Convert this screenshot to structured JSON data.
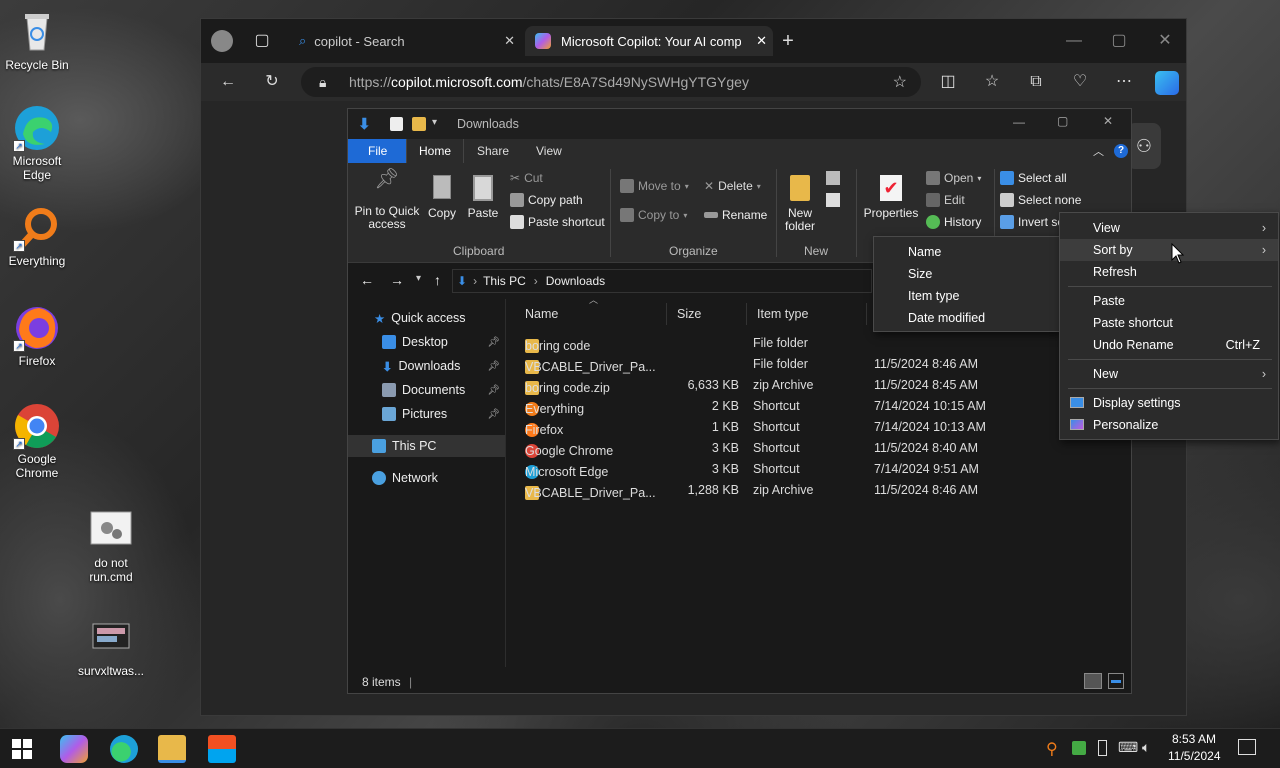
{
  "desktop": {
    "icons": [
      {
        "name": "recycle-bin",
        "label": "Recycle Bin"
      },
      {
        "name": "microsoft-edge",
        "label": "Microsoft Edge"
      },
      {
        "name": "everything",
        "label": "Everything"
      },
      {
        "name": "firefox",
        "label": "Firefox"
      },
      {
        "name": "google-chrome",
        "label": "Google Chrome"
      },
      {
        "name": "do-not-run",
        "label": "do not run.cmd"
      },
      {
        "name": "survxltwas",
        "label": "survxltwas..."
      }
    ]
  },
  "browser": {
    "tabs": [
      {
        "label": "copilot - Search",
        "icon": "search-icon"
      },
      {
        "label": "Microsoft Copilot: Your AI compa",
        "icon": "copilot-icon"
      }
    ],
    "url_prefix": "https://",
    "url_domain": "copilot.microsoft.com",
    "url_path": "/chats/E8A7Sd49NySWHgYTGYgey"
  },
  "explorer": {
    "title": "Downloads",
    "ribbon_tabs": [
      "File",
      "Home",
      "Share",
      "View"
    ],
    "clipboard": {
      "pin": "Pin to Quick access",
      "copy": "Copy",
      "paste": "Paste",
      "cut": "Cut",
      "copy_path": "Copy path",
      "paste_shortcut": "Paste shortcut",
      "group": "Clipboard"
    },
    "organize": {
      "move_to": "Move to",
      "copy_to": "Copy to",
      "delete": "Delete",
      "rename": "Rename",
      "group": "Organize"
    },
    "new": {
      "new_folder": "New folder",
      "group": "New"
    },
    "open": {
      "properties": "Properties",
      "open": "Open",
      "edit": "Edit",
      "history": "History"
    },
    "select": {
      "select_all": "Select all",
      "select_none": "Select none",
      "invert": "Invert se"
    },
    "breadcrumb": [
      "This PC",
      "Downloads"
    ],
    "sidebar": [
      {
        "label": "Quick access",
        "icon": "star-icon"
      },
      {
        "label": "Desktop",
        "icon": "desktop-icon",
        "pinned": true
      },
      {
        "label": "Downloads",
        "icon": "download-icon",
        "pinned": true
      },
      {
        "label": "Documents",
        "icon": "documents-icon",
        "pinned": true
      },
      {
        "label": "Pictures",
        "icon": "pictures-icon",
        "pinned": true
      },
      {
        "label": "This PC",
        "icon": "computer-icon"
      },
      {
        "label": "Network",
        "icon": "network-icon"
      }
    ],
    "columns": [
      "Name",
      "Size",
      "Item type"
    ],
    "files": [
      {
        "name": "boring code",
        "size": "",
        "type": "File folder",
        "date": "",
        "icon": "folder"
      },
      {
        "name": "VBCABLE_Driver_Pa...",
        "size": "",
        "type": "File folder",
        "date": "11/5/2024 8:46 AM",
        "icon": "folder"
      },
      {
        "name": "boring code.zip",
        "size": "6,633 KB",
        "type": "zip Archive",
        "date": "11/5/2024 8:45 AM",
        "icon": "zip"
      },
      {
        "name": "Everything",
        "size": "2 KB",
        "type": "Shortcut",
        "date": "7/14/2024 10:15 AM",
        "icon": "everything"
      },
      {
        "name": "Firefox",
        "size": "1 KB",
        "type": "Shortcut",
        "date": "7/14/2024 10:13 AM",
        "icon": "firefox"
      },
      {
        "name": "Google Chrome",
        "size": "3 KB",
        "type": "Shortcut",
        "date": "11/5/2024 8:40 AM",
        "icon": "chrome"
      },
      {
        "name": "Microsoft Edge",
        "size": "3 KB",
        "type": "Shortcut",
        "date": "7/14/2024 9:51 AM",
        "icon": "edge"
      },
      {
        "name": "VBCABLE_Driver_Pa...",
        "size": "1,288 KB",
        "type": "zip Archive",
        "date": "11/5/2024 8:46 AM",
        "icon": "zip"
      }
    ],
    "status": "8 items"
  },
  "context_menu": {
    "items": [
      {
        "label": "View",
        "submenu": true
      },
      {
        "label": "Sort by",
        "submenu": true
      },
      {
        "label": "Refresh"
      },
      {
        "label": "Paste"
      },
      {
        "label": "Paste shortcut"
      },
      {
        "label": "Undo Rename",
        "shortcut": "Ctrl+Z"
      },
      {
        "label": "New",
        "submenu": true
      },
      {
        "label": "Display settings",
        "icon": "display-icon"
      },
      {
        "label": "Personalize",
        "icon": "personalize-icon"
      }
    ]
  },
  "sort_menu": {
    "items": [
      "Name",
      "Size",
      "Item type",
      "Date modified"
    ]
  },
  "taskbar": {
    "time": "8:53 AM",
    "date": "11/5/2024"
  },
  "colors": {
    "accent": "#1e6ad6",
    "explorer_bg": "#191919",
    "ribbon_bg": "#2b2b2b",
    "folder": "#e8b84a"
  }
}
